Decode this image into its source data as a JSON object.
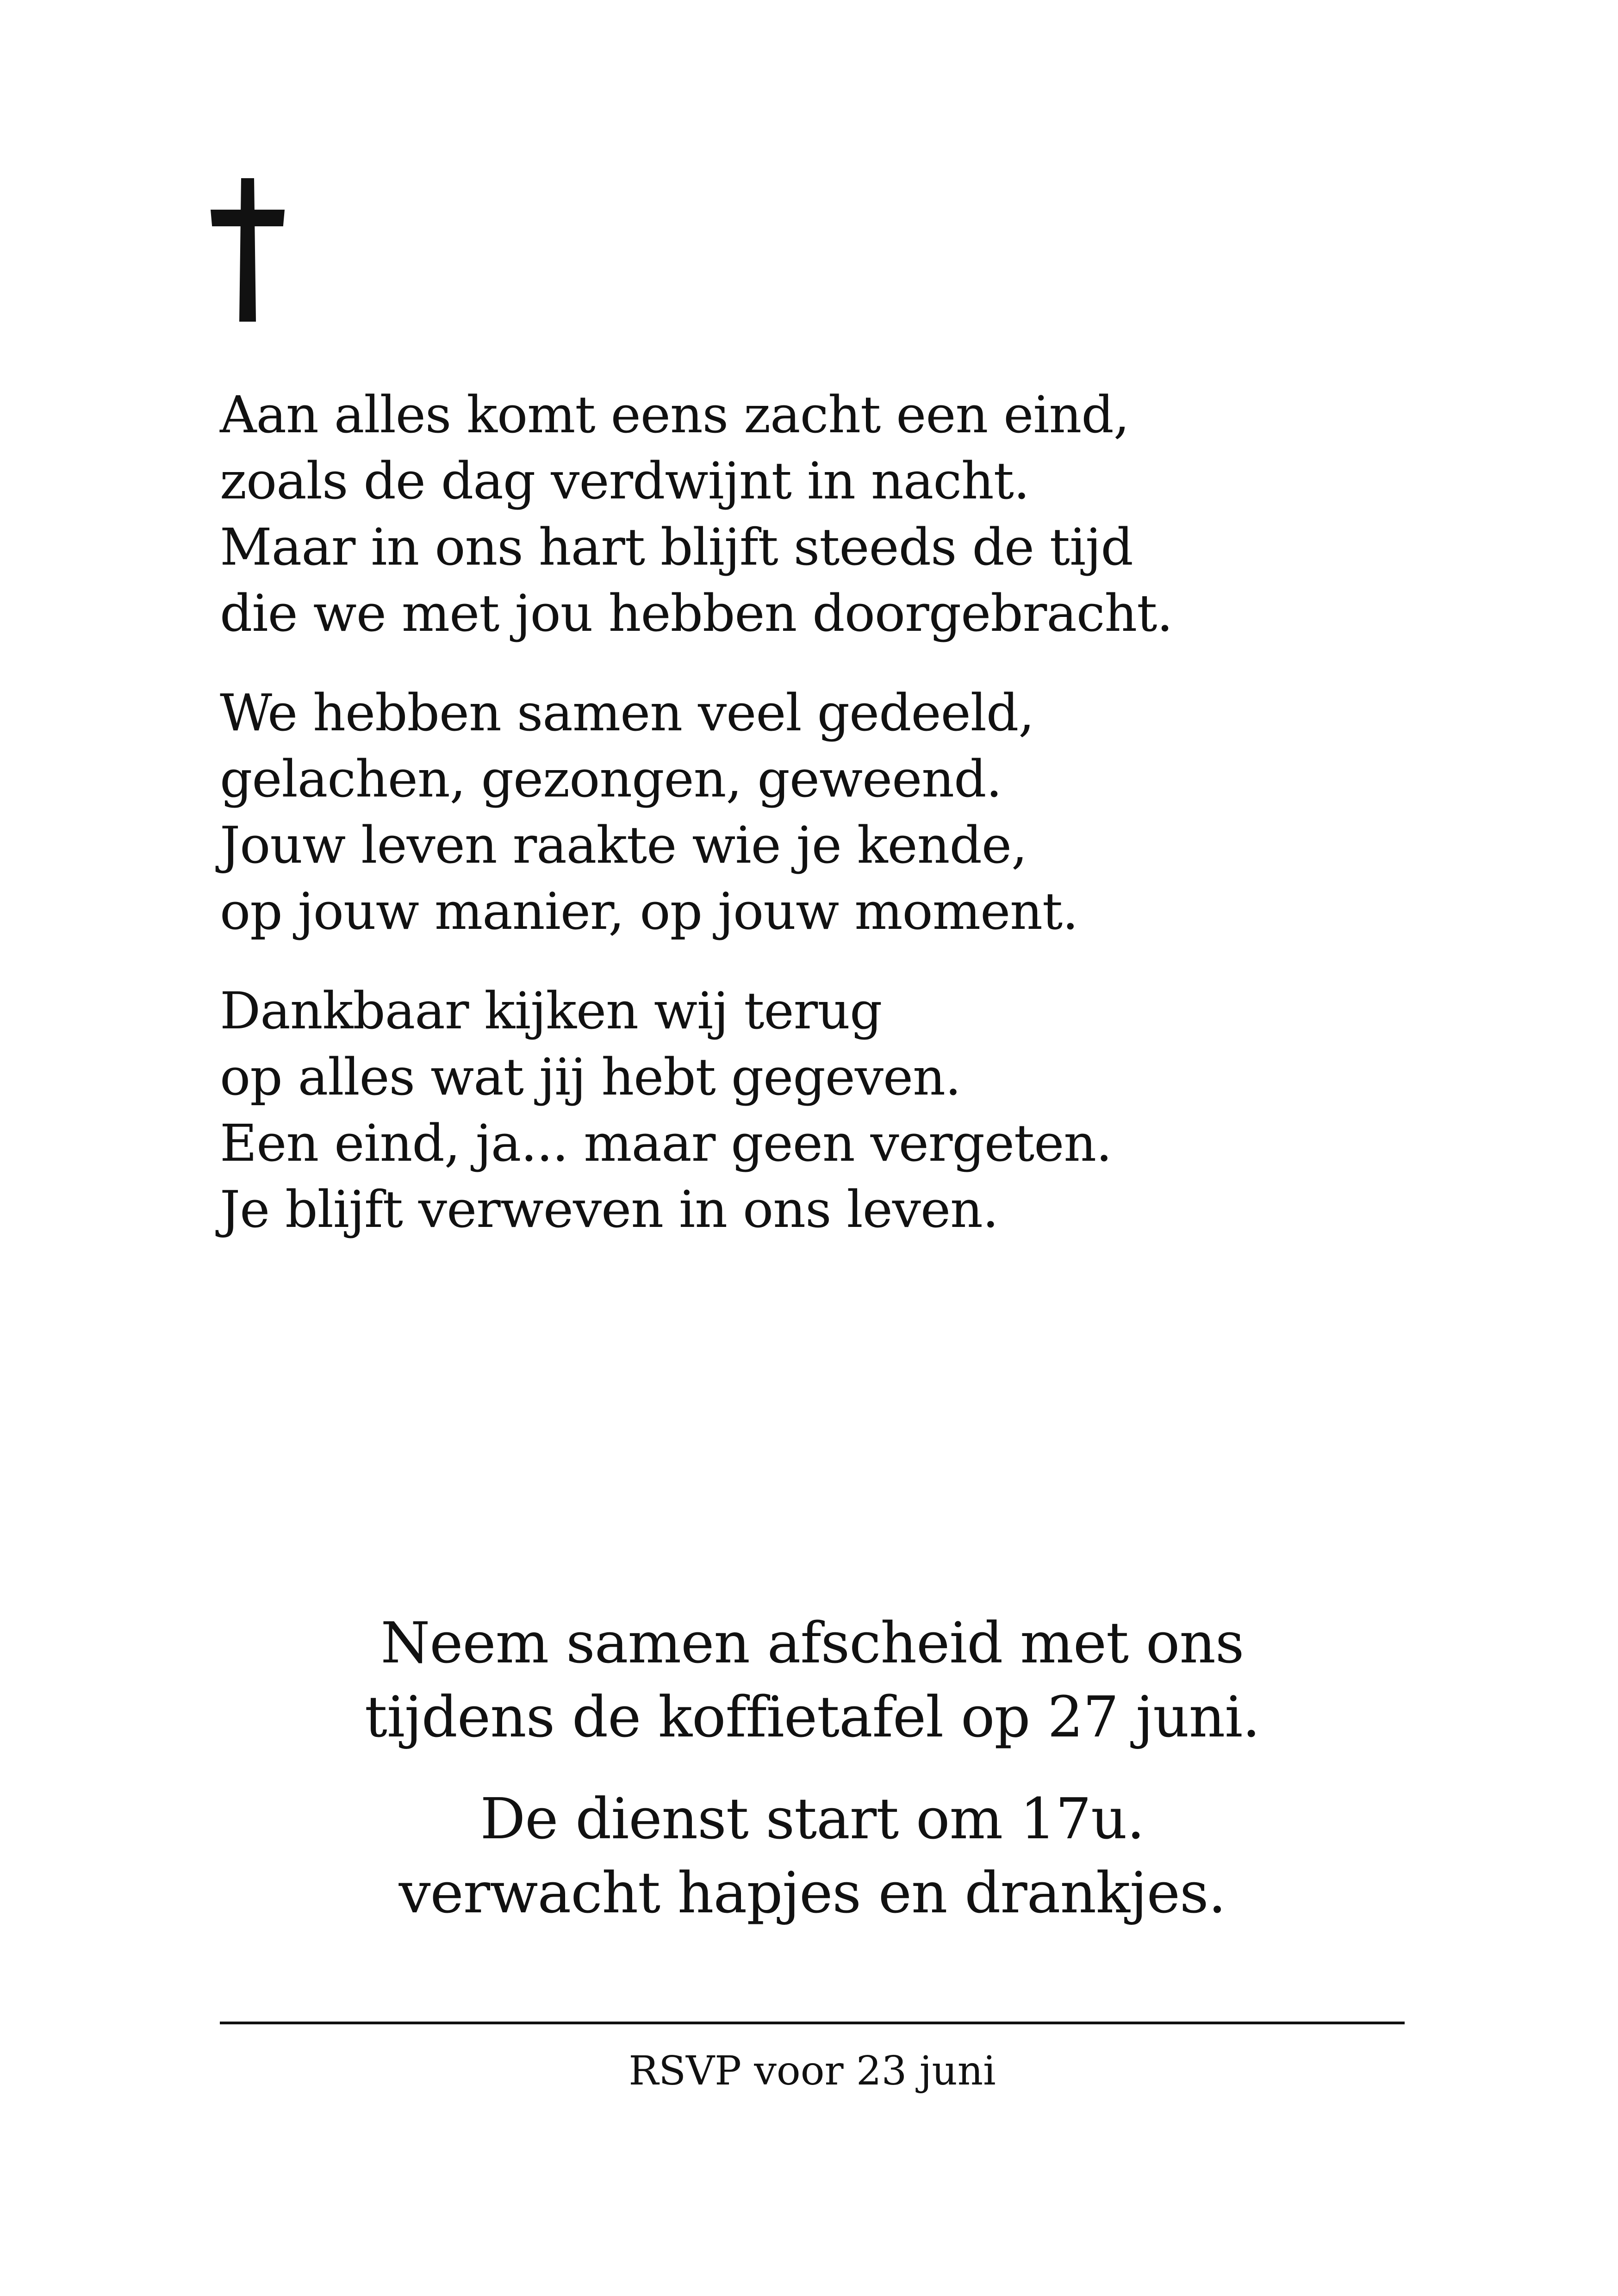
{
  "icon": "cross-icon",
  "poem": {
    "stanzas": [
      {
        "lines": [
          "Aan alles komt eens zacht een eind,",
          "zoals de dag verdwijnt in nacht.",
          "Maar in ons hart blijft steeds de tijd",
          "die we met jou hebben doorgebracht."
        ]
      },
      {
        "lines": [
          "We hebben samen veel gedeeld,",
          "gelachen, gezongen, geweend.",
          "Jouw leven raakte wie je kende,",
          "op jouw manier, op jouw moment."
        ]
      },
      {
        "lines": [
          "Dankbaar kijken wij terug",
          "op alles wat jij hebt gegeven.",
          "Een eind, ja... maar geen vergeten.",
          "Je blijft verweven in ons leven."
        ]
      }
    ]
  },
  "invitation": {
    "block1": [
      "Neem samen afscheid met ons",
      "tijdens de koffietafel op 27 juni."
    ],
    "block2": [
      "De dienst start om 17u.",
      "verwacht hapjes en drankjes."
    ]
  },
  "rsvp": "RSVP voor 23 juni",
  "colors": {
    "text": "#111111",
    "background": "#ffffff"
  }
}
